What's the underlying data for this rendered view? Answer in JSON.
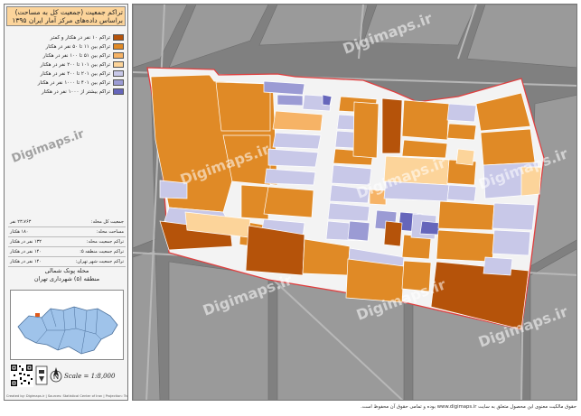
{
  "panel": {
    "title": "تراکم جمعیت (جمعیت کل به مساحت)\nبراساس داده‌های مرکز آمار ایران ۱۳۹۵",
    "legend": [
      {
        "label": "تراکم ۱۰ نفر در هکتار و کمتر",
        "color": "#b5530a"
      },
      {
        "label": "تراکم بین ۱۱ تا ۵۰ نفر در هکتار",
        "color": "#e08a26"
      },
      {
        "label": "تراکم بین ۵۱ تا ۱۰۰ نفر در هکتار",
        "color": "#f6b366"
      },
      {
        "label": "تراکم بین ۱۰۱ تا ۲۰۰ نفر در هکتار",
        "color": "#fcd49a"
      },
      {
        "label": "تراکم بین ۲۰۱ تا ۴۰۰ نفر در هکتار",
        "color": "#c8c8e8"
      },
      {
        "label": "تراکم بین ۴۰۱ تا ۱۰۰۰ نفر در هکتار",
        "color": "#9b9bd4"
      },
      {
        "label": "تراکم بیشتر از ۱۰۰۰ نفر در هکتار",
        "color": "#6666bb"
      }
    ],
    "stats": [
      {
        "label": "جمعیت کل محله:",
        "value": "۲۳،۷۶۳ نفر"
      },
      {
        "label": "مساحت محله:",
        "value": "۱۸۰ هکتار"
      },
      {
        "label": "تراکم جمعیت محله:",
        "value": "۱۳۲ نفر در هکتار"
      },
      {
        "label": "تراکم جمعیت منطقه ۵:",
        "value": "۱۴۰ نفر در هکتار"
      },
      {
        "label": "تراکم جمعیت شهر تهران:",
        "value": "۱۴۰ نفر در هکتار"
      }
    ],
    "neighborhood": "محله پونک شمالی\nمنطقه (۵) شهرداری تهران",
    "scale": "Scale = 1:8,000",
    "credit": "Created by: Digimaps.ir | Sources: Statistical Center of Iran | Projection: Transverse Mercator"
  },
  "watermark": "Digimaps.ir",
  "footer": "حقوق مالکیت معنوی این محصول متعلق به سایت www.digimaps.ir بوده و تمامی حقوق آن محفوظ است."
}
